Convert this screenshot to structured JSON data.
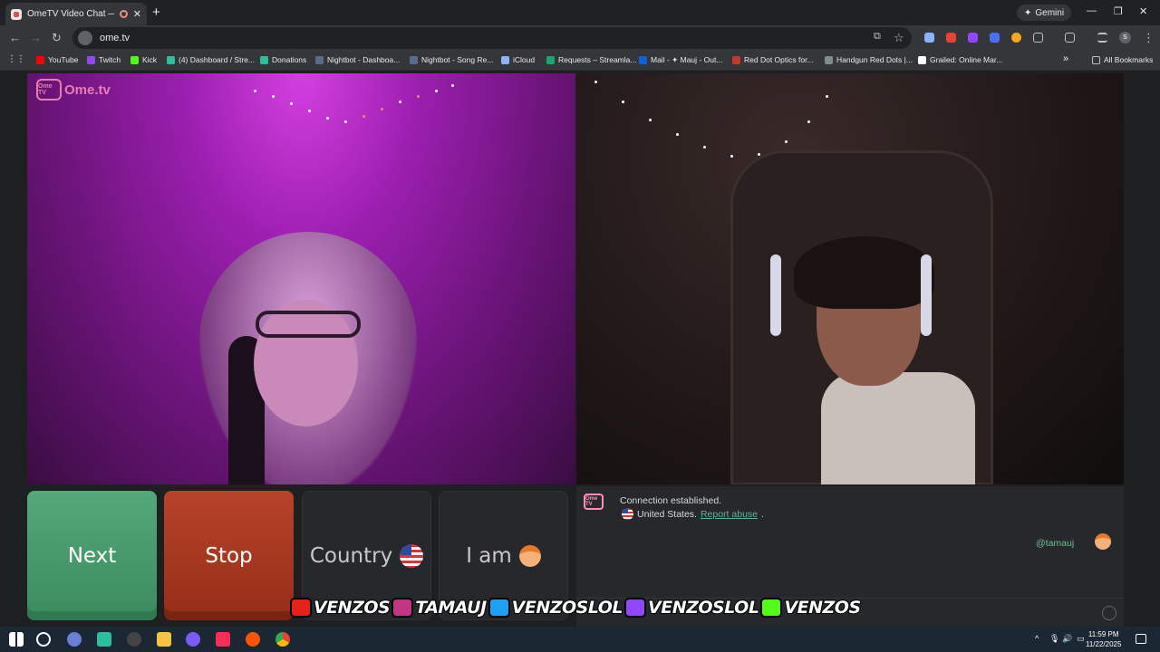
{
  "browser": {
    "tab_title": "OmeTV Video Chat — Ome",
    "tab_close": "✕",
    "new_tab": "+",
    "gemini_label": "Gemini",
    "gemini_icon": "✦",
    "min": "—",
    "restore": "❐",
    "close": "✕",
    "url": "ome.tv",
    "back": "←",
    "forward": "→",
    "reload": "↻",
    "star": "☆",
    "menu": "⋮",
    "profile_initial": "S"
  },
  "bookmarks": {
    "apps_icon": "⋮⋮",
    "items": [
      {
        "label": "YouTube",
        "color": "#ff0000"
      },
      {
        "label": "Twitch",
        "color": "#9146ff"
      },
      {
        "label": "Kick",
        "color": "#53fc18"
      },
      {
        "label": "(4) Dashboard / Stre...",
        "color": "#2bbf9f"
      },
      {
        "label": "Donations",
        "color": "#2bbf9f"
      },
      {
        "label": "Nightbot - Dashboa...",
        "color": "#5b6b8c"
      },
      {
        "label": "Nightbot - Song Re...",
        "color": "#5b6b8c"
      },
      {
        "label": "iCloud",
        "color": "#8ab4f8"
      },
      {
        "label": "Requests – Streamla...",
        "color": "#17a673"
      },
      {
        "label": "Mail - ✦ Mauj - Out...",
        "color": "#0a64d6"
      },
      {
        "label": "Red Dot Optics for...",
        "color": "#c0392b"
      },
      {
        "label": "Handgun Red Dots |...",
        "color": "#7f8c8d"
      },
      {
        "label": "Grailed: Online Mar...",
        "color": "#ffffff"
      }
    ],
    "overflow": "»",
    "all_bookmarks": "All Bookmarks"
  },
  "ometv": {
    "logo_box": "Ome TV",
    "logo_text": "Ome.tv",
    "buttons": {
      "next": "Next",
      "stop": "Stop",
      "country": "Country",
      "iam": "I am"
    },
    "chat": {
      "logo": "Ome TV",
      "connection": "Connection established.",
      "country": "United States.",
      "report": "Report abuse",
      "period": ".",
      "handle": "@tamauj"
    }
  },
  "overlay": {
    "socials": [
      {
        "platform": "youtube-icon",
        "color": "#e62117",
        "text": "VENZOS"
      },
      {
        "platform": "instagram-icon",
        "color": "#c13584",
        "text": "TAMAUJ"
      },
      {
        "platform": "twitter-icon",
        "color": "#1da1f2",
        "text": "VENZOSLOL"
      },
      {
        "platform": "twitch-icon",
        "color": "#9146ff",
        "text": "VENZOSLOL"
      },
      {
        "platform": "kick-icon",
        "color": "#53fc18",
        "text": "VENZOS"
      }
    ]
  },
  "taskbar": {
    "time": "11:59 PM",
    "date": "11/22/2025",
    "tray_chevron": "^"
  }
}
